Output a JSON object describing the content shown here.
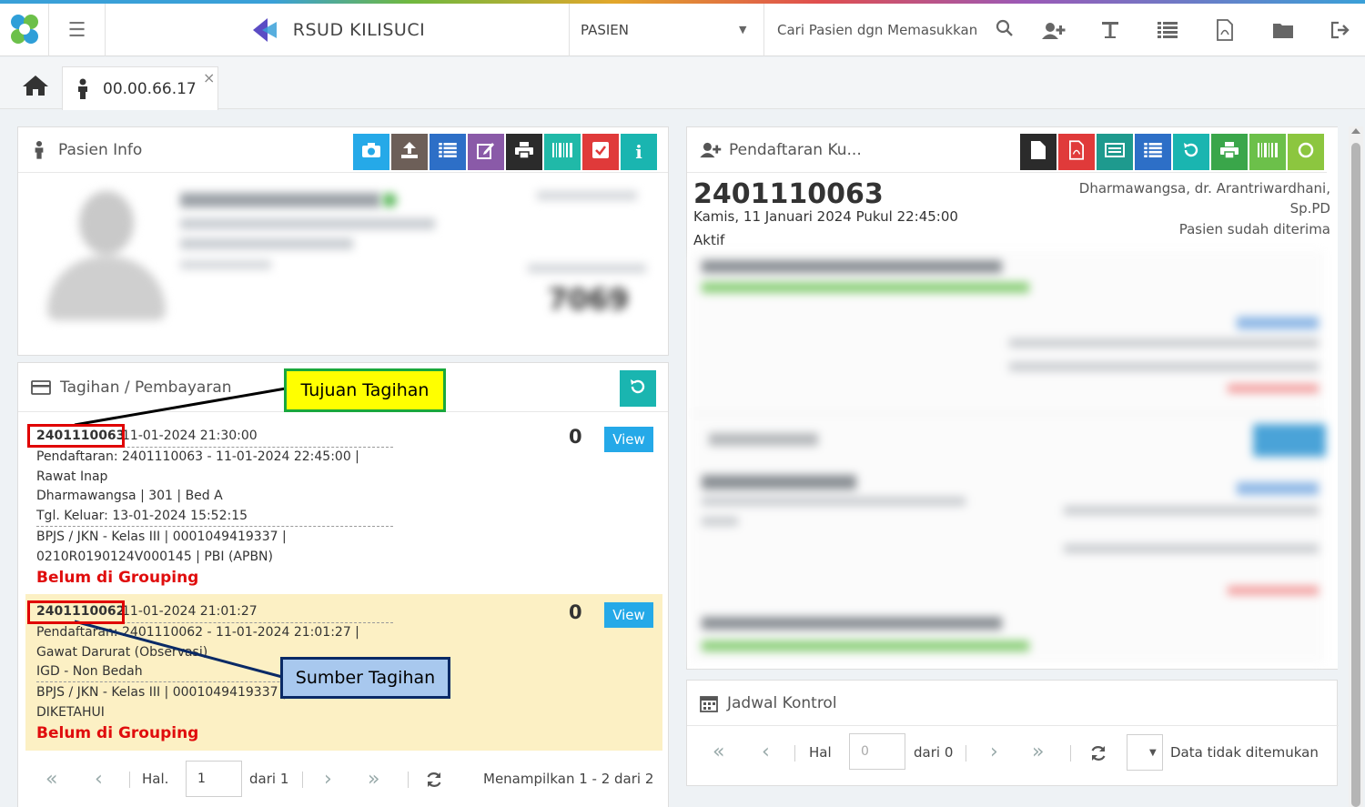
{
  "colors": {
    "accent": "#25a9e8",
    "danger": "#e00d0d",
    "teal": "#1ab5b0",
    "green": "#5cb85c",
    "brown": "#6d5f58",
    "darkred": "#c9302c",
    "yellow_row": "#fcf0c4"
  },
  "navbar": {
    "hospital_name": "RSUD KILISUCI",
    "module_select": "PASIEN",
    "search_placeholder": "Cari Pasien dgn Memasukkan"
  },
  "tab": {
    "label": "00.00.66.17",
    "close": "×"
  },
  "patient_info": {
    "title": "Pasien Info",
    "blurred_tail": "7069"
  },
  "registration": {
    "title": "Pendaftaran Ku...",
    "number": "2401110063",
    "datetime": "Kamis, 11 Januari 2024 Pukul 22:45:00",
    "status": "Aktif",
    "doctor_line1": "Dharmawangsa, dr. Arantriwardhani,",
    "doctor_line2": "Sp.PD",
    "received": "Pasien sudah diterima"
  },
  "billing": {
    "title": "Tagihan / Pembayaran",
    "items": [
      {
        "id": "2401110063",
        "date": " 11-01-2024 21:30:00",
        "line1": "Pendaftaran: 2401110063 - 11-01-2024 22:45:00 |",
        "line2": "Rawat Inap",
        "line3": "Dharmawangsa | 301 | Bed A",
        "line4": "Tgl. Keluar: 13-01-2024 15:52:15",
        "line5": "BPJS / JKN - Kelas III | 0001049419337 |",
        "line6": "0210R0190124V000145 | PBI (APBN)",
        "status": "Belum di Grouping",
        "amount": "0",
        "view": "View"
      },
      {
        "id": "2401110062",
        "date": " 11-01-2024 21:01:27",
        "line1": "Pendaftaran: 2401110062 - 11-01-2024 21:01:27 |",
        "line2": "Gawat Darurat (Observasi)",
        "line3": "IGD - Non Bedah",
        "line5": "BPJS / JKN - Kelas III | 0001049419337 |",
        "line6": "DIKETAHUI",
        "status": "Belum di Grouping",
        "amount": "0",
        "view": "View"
      }
    ],
    "pager": {
      "hal": "Hal.",
      "page": "1",
      "of": "dari 1",
      "summary": "Menampilkan 1 - 2 dari 2"
    }
  },
  "annotations": {
    "target": "Tujuan Tagihan",
    "source": "Sumber Tagihan"
  },
  "schedule": {
    "title": "Jadwal Kontrol",
    "pager": {
      "hal": "Hal",
      "page": "0",
      "of": "dari 0",
      "empty": "Data tidak ditemukan"
    }
  }
}
